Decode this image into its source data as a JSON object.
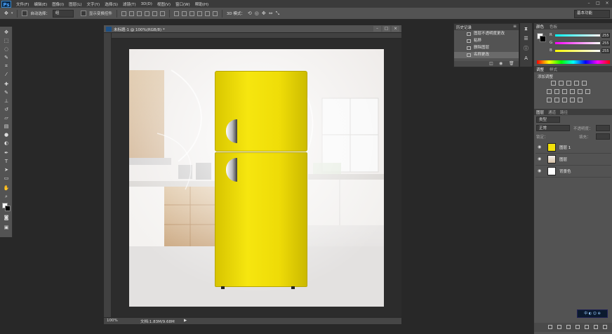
{
  "app": {
    "logo": "Ps"
  },
  "menu": [
    "文件(F)",
    "编辑(E)",
    "图像(I)",
    "图层(L)",
    "文字(Y)",
    "选择(S)",
    "滤镜(T)",
    "3D(D)",
    "视图(V)",
    "窗口(W)",
    "帮助(H)"
  ],
  "window_controls": [
    "–",
    "□",
    "×"
  ],
  "options_bar": {
    "auto_select_label": "自动选择：",
    "auto_select_value": "组",
    "transform_label": "显示变换控件",
    "mode_3d_label": "3D 模式：",
    "workspace": "基本功能"
  },
  "document": {
    "tab_title": "未标题-1 @ 100%(RGB/8) *",
    "controls": [
      "–",
      "□",
      "×"
    ],
    "zoom": "100%",
    "doc_size": "文档:1.83M/9.68M",
    "status_arrow": "▶"
  },
  "history": {
    "tab": "历史记录",
    "items": [
      "图层不透明度更改",
      "粘移",
      "删除图层",
      "名称更改"
    ],
    "selected_index": 3
  },
  "color_panel": {
    "tabs": [
      "颜色",
      "色板"
    ],
    "channels": [
      {
        "label": "R",
        "value": "255"
      },
      {
        "label": "G",
        "value": "255"
      },
      {
        "label": "B",
        "value": "255"
      }
    ]
  },
  "adjustments_panel": {
    "tabs": [
      "调整",
      "样式"
    ],
    "title": "添加调整"
  },
  "layers_panel": {
    "tabs": [
      "图层",
      "通道",
      "路径"
    ],
    "kind_filter": "类型",
    "blend_mode": "正常",
    "opacity_label": "不透明度：",
    "lock_label": "锁定：",
    "fill_label": "填充：",
    "layers": [
      {
        "name": "图层 1"
      },
      {
        "name": "图层"
      },
      {
        "name": "背景色"
      }
    ]
  },
  "taskbar_badge": "中 ◐ ☺ ⊕",
  "colors": {
    "accent": "#4aa3ff",
    "fridge": "#f2e10a",
    "panel": "#535353",
    "background": "#282828"
  }
}
